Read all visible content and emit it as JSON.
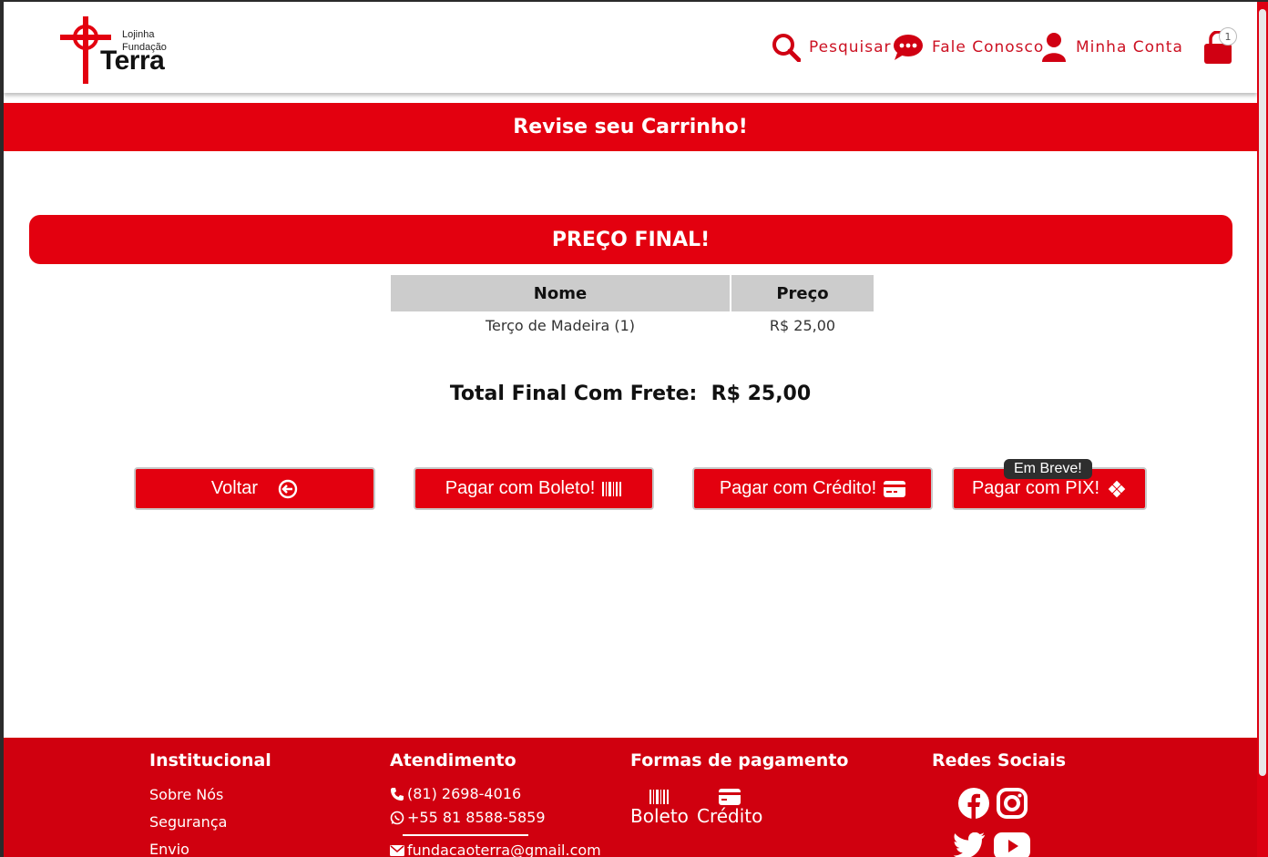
{
  "header": {
    "logo": {
      "line1": "Lojinha",
      "line2": "Fundação",
      "line3": "Terra"
    },
    "nav": {
      "search": "Pesquisar",
      "contact": "Fale Conosco",
      "account": "Minha Conta"
    },
    "cart_count": "1"
  },
  "banner": {
    "title": "Revise seu Carrinho!"
  },
  "summary": {
    "heading": "PREÇO FINAL!",
    "table": {
      "headers": [
        "Nome",
        "Preço"
      ],
      "rows": [
        {
          "name": "Terço de Madeira (1)",
          "price": "R$ 25,00"
        }
      ]
    },
    "total_label": "Total Final Com Frete:",
    "total_value": "R$ 25,00"
  },
  "actions": {
    "back": "Voltar",
    "boleto": "Pagar com Boleto!",
    "credit": "Pagar com Crédito!",
    "pix": "Pagar com PIX!",
    "pix_tooltip": "Em Breve!"
  },
  "footer": {
    "institutional": {
      "title": "Institucional",
      "links": [
        "Sobre Nós",
        "Segurança",
        "Envio"
      ]
    },
    "support": {
      "title": "Atendimento",
      "phone": "(81) 2698-4016",
      "whatsapp": "+55 81 8588-5859",
      "email": "fundacaoterra@gmail.com"
    },
    "payment": {
      "title": "Formas de pagamento",
      "methods": [
        "Boleto",
        "Crédito"
      ]
    },
    "social": {
      "title": "Redes Sociais",
      "networks": [
        "facebook-icon",
        "instagram-icon",
        "twitter-icon",
        "youtube-icon"
      ]
    }
  },
  "colors": {
    "brand_red": "#e3000f",
    "footer_red": "#d0000f"
  }
}
